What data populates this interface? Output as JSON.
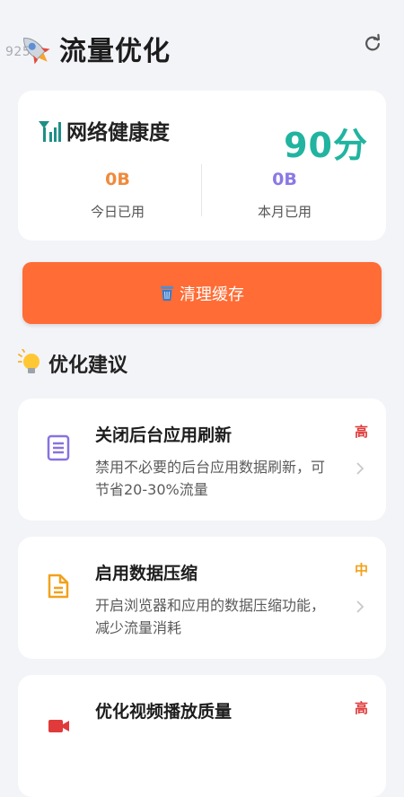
{
  "header": {
    "title": "流量优化",
    "watermark": "925",
    "logo_icon": "rocket-icon",
    "refresh_icon": "refresh-icon"
  },
  "health": {
    "title": "网络健康度",
    "score": "90分",
    "score_color": "#21b4a0",
    "icon": "signal-bars-icon",
    "today": {
      "value": "0B",
      "label": "今日已用",
      "color": "#f08a3c"
    },
    "month": {
      "value": "0B",
      "label": "本月已用",
      "color": "#8b78e6"
    }
  },
  "clean_button": {
    "label": "清理缓存",
    "icon": "trash-icon",
    "color": "#ff6c35"
  },
  "suggestions_section": {
    "title": "优化建议",
    "icon": "lightbulb-icon",
    "items": [
      {
        "title": "关闭后台应用刷新",
        "desc": "禁用不必要的后台应用数据刷新，可节省20-30%流量",
        "priority": "高",
        "icon": "document-icon",
        "icon_color": "#8a72df"
      },
      {
        "title": "启用数据压缩",
        "desc": "开启浏览器和应用的数据压缩功能，减少流量消耗",
        "priority": "中",
        "icon": "file-icon",
        "icon_color": "#f2a21b"
      },
      {
        "title": "优化视频播放质量",
        "desc": "",
        "priority": "高",
        "icon": "video-icon",
        "icon_color": "#e03a3a"
      }
    ]
  }
}
